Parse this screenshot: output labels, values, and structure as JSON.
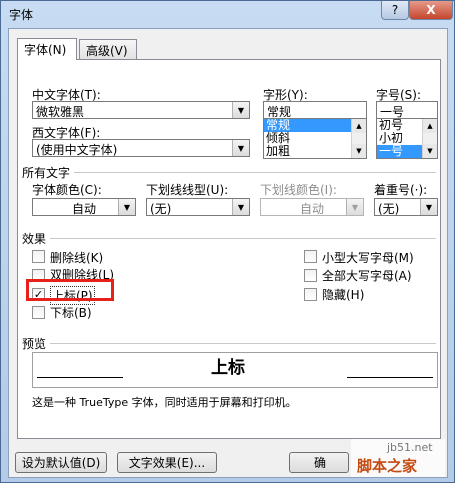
{
  "window": {
    "title": "字体",
    "help_glyph": "?",
    "close_glyph": "X"
  },
  "tabs": [
    {
      "label": "字体(N)"
    },
    {
      "label": "高级(V)"
    }
  ],
  "chinese_font": {
    "label": "中文字体(T):",
    "value": "微软雅黑"
  },
  "western_font": {
    "label": "西文字体(F):",
    "value": "(使用中文字体)"
  },
  "font_style": {
    "label": "字形(Y):",
    "value": "常规",
    "options": [
      "常规",
      "倾斜",
      "加粗"
    ],
    "selected": "常规"
  },
  "font_size": {
    "label": "字号(S):",
    "value": "一号",
    "options": [
      "初号",
      "小初",
      "一号"
    ],
    "selected": "一号"
  },
  "all_text": {
    "heading": "所有文字",
    "font_color": {
      "label": "字体颜色(C):",
      "value": "自动"
    },
    "underline_style": {
      "label": "下划线线型(U):",
      "value": "(无)"
    },
    "underline_color": {
      "label": "下划线颜色(I):",
      "value": "自动"
    },
    "emphasis_mark": {
      "label": "着重号(·):",
      "value": "(无)"
    }
  },
  "effects": {
    "heading": "效果",
    "strikethrough": "删除线(K)",
    "double_strikethrough": "双删除线(L)",
    "superscript": "上标(P)",
    "subscript": "下标(B)",
    "small_caps": "小型大写字母(M)",
    "all_caps": "全部大写字母(A)",
    "hidden": "隐藏(H)",
    "check_mark": "✓"
  },
  "preview": {
    "heading": "预览",
    "sample": "上标",
    "note": "这是一种 TrueType 字体，同时适用于屏幕和打印机。"
  },
  "buttons": {
    "set_default": "设为默认值(D)",
    "text_effects": "文字效果(E)...",
    "ok_partial": "确"
  },
  "watermark": {
    "line1": "jb51.net",
    "line2": "脚本之家"
  },
  "colors": {
    "highlight": "#3399ff",
    "annotation_red": "#e8201a"
  }
}
